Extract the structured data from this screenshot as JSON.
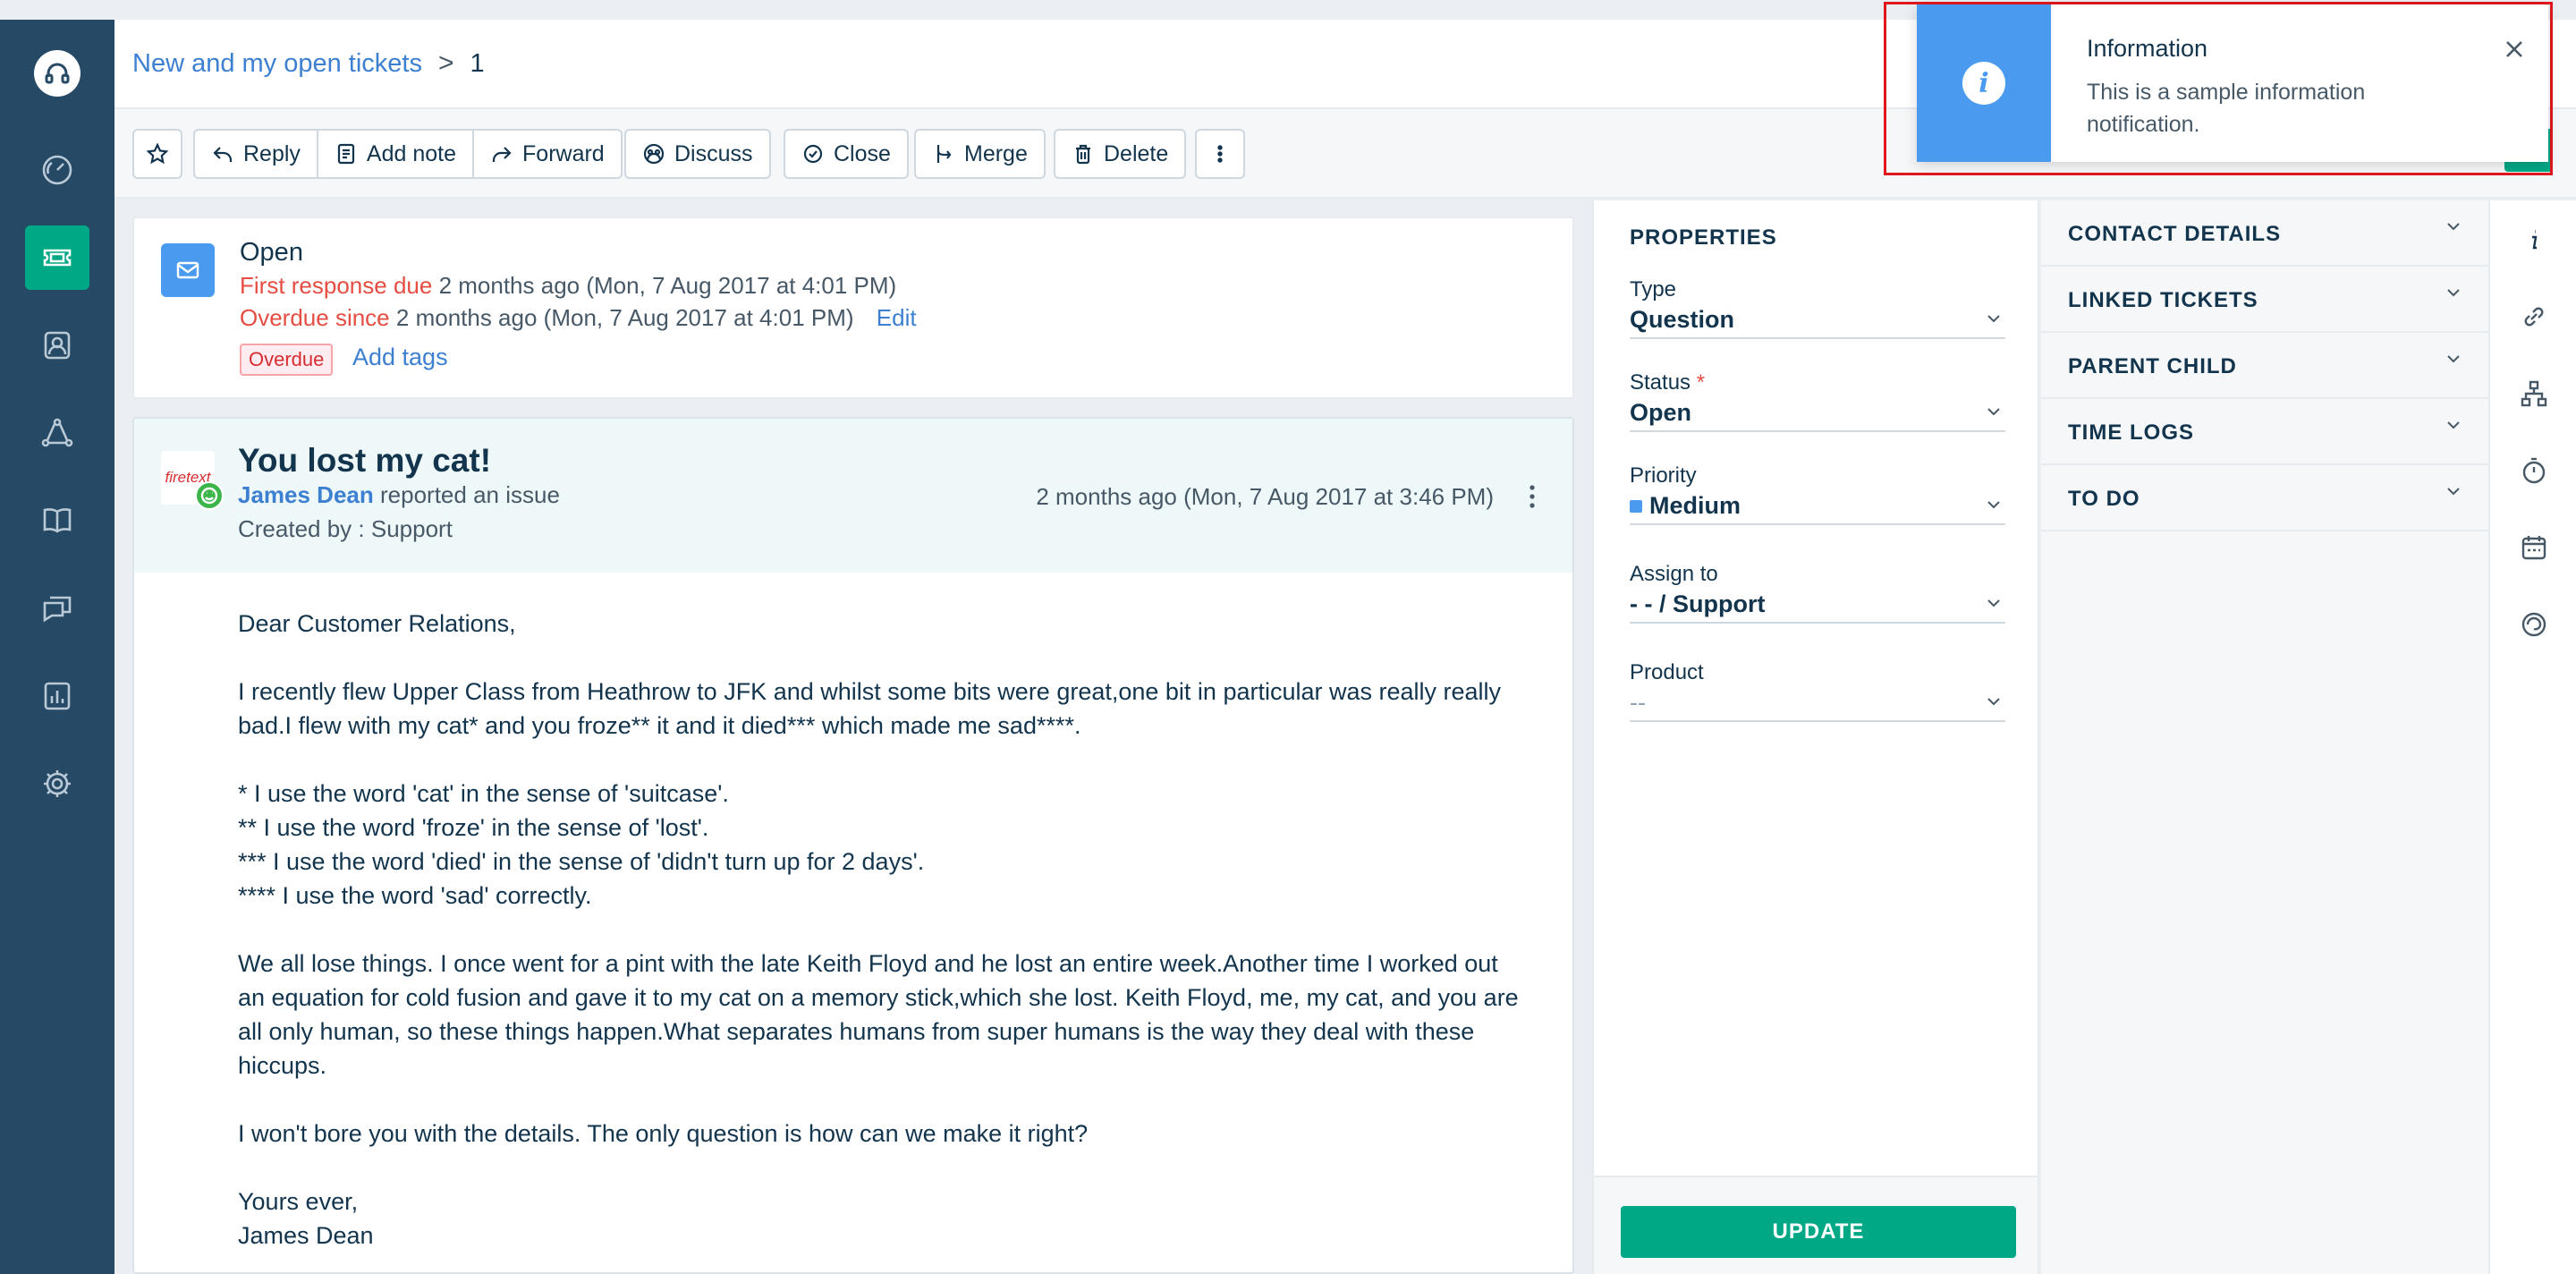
{
  "breadcrumb": {
    "link": "New and my open tickets",
    "separator": ">",
    "current": "1"
  },
  "toolbar": {
    "reply": "Reply",
    "add_note": "Add note",
    "forward": "Forward",
    "discuss": "Discuss",
    "close": "Close",
    "merge": "Merge",
    "delete": "Delete"
  },
  "status": {
    "title": "Open",
    "first_response_label": "First response due",
    "first_response_time": "2 months ago (Mon, 7 Aug 2017 at 4:01 PM)",
    "overdue_label": "Overdue since",
    "overdue_time": "2 months ago (Mon, 7 Aug 2017 at 4:01 PM)",
    "edit": "Edit",
    "badge": "Overdue",
    "add_tags": "Add tags"
  },
  "conversation": {
    "avatar_text": "firetext",
    "subject": "You lost my cat!",
    "reporter": "James Dean",
    "reporter_action": "reported an issue",
    "created_by": "Created by : Support",
    "time": "2 months ago (Mon, 7 Aug 2017 at 3:46 PM)",
    "body": {
      "p1": "Dear Customer Relations,",
      "p2": "I recently flew Upper Class from Heathrow to JFK and whilst some bits were great,one bit in particular was really really bad.I flew with my cat* and you froze** it and it died*** which made me sad****.",
      "p3_l1": "* I use the word 'cat' in the sense of 'suitcase'.",
      "p3_l2": "** I use the word 'froze' in the sense of 'lost'.",
      "p3_l3": "*** I use the word 'died' in the sense of 'didn't turn up for 2 days'.",
      "p3_l4": "**** I use the word 'sad' correctly.",
      "p4": "We all lose things. I once went for a pint with the late Keith Floyd and he lost an entire week.Another time I worked out an equation for cold fusion and gave it to my cat on a memory stick,which she lost. Keith Floyd, me, my cat, and you are all only human, so these things happen.What separates humans from super humans is the way they deal with these hiccups.",
      "p5": "I won't bore you with the details. The only question is how can we make it right?",
      "p6_l1": "Yours ever,",
      "p6_l2": "James Dean"
    }
  },
  "properties": {
    "title": "PROPERTIES",
    "type_label": "Type",
    "type_value": "Question",
    "status_label": "Status",
    "status_required": "*",
    "status_value": "Open",
    "priority_label": "Priority",
    "priority_value": "Medium",
    "assign_label": "Assign to",
    "assign_value": "- - / Support",
    "product_label": "Product",
    "product_value": "--",
    "update": "UPDATE"
  },
  "accordion": {
    "contact": "CONTACT DETAILS",
    "linked": "LINKED TICKETS",
    "parent": "PARENT CHILD",
    "time": "TIME LOGS",
    "todo": "TO DO"
  },
  "toast": {
    "title": "Information",
    "message": "This is a sample information notification.",
    "icon": "i"
  },
  "colors": {
    "nav_bg": "#264966",
    "accent_green": "#00a886",
    "info_blue": "#4a9bef",
    "overdue_red": "#e54d42",
    "toast_highlight": "#e0181e"
  },
  "icons": {
    "nav": [
      "headset-icon",
      "dashboard-icon",
      "tickets-icon",
      "contacts-icon",
      "social-icon",
      "solutions-icon",
      "forums-icon",
      "reports-icon",
      "admin-gear-icon"
    ],
    "rail": [
      "info-icon",
      "link-icon",
      "hierarchy-icon",
      "timer-icon",
      "calendar-icon",
      "app-icon"
    ]
  }
}
